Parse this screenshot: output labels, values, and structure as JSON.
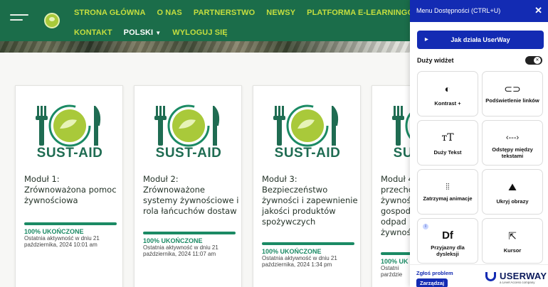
{
  "header": {
    "nav_row1": [
      "STRONA GŁÓWNA",
      "O NAS",
      "PARTNERSTWO",
      "NEWSY",
      "PLATFORMA E-LEARNINGOWA"
    ],
    "nav_row2": [
      "KONTAKT",
      "WYLOGUJ SIĘ"
    ],
    "language": "POLSKI",
    "colors": {
      "bar": "#1b6d4a",
      "link": "#c5de3f"
    }
  },
  "brand_text": "SUST-AID",
  "cards": [
    {
      "title": "Moduł 1:\nZrównoważona pomoc żywnościowa",
      "status": "100% UKOŃCZONE",
      "activity": "Ostatnia aktywność w dniu 21 października, 2024 10:01 am"
    },
    {
      "title": "Moduł 2:\nZrównoważone systemy żywnościowe i rola łańcuchów dostaw",
      "status": "100% UKOŃCZONE",
      "activity": "Ostatnia aktywność w dniu 21 października, 2024 11:07 am"
    },
    {
      "title": "Moduł 3:\nBezpieczeństwo żywności i zapewnienie jakości produktów spożywczych",
      "status": "100% UKOŃCZONE",
      "activity": "Ostatnia aktywność w dniu 21 października, 2024 1:34 pm"
    },
    {
      "title": "Moduł 4\nprzechc\nżywnośc\ngospod\nodpad\nżywnośc",
      "status": "100% UK",
      "activity": "Ostatni\nparździe"
    }
  ],
  "accessibility": {
    "title": "Menu Dostępności (CTRL+U)",
    "how_button": "Jak działa UserWay",
    "big_widget": "Duży widżet",
    "tiles": [
      {
        "label": "Kontrast +",
        "icon": "contrast-icon"
      },
      {
        "label": "Podświetlenie linków",
        "icon": "link-icon"
      },
      {
        "label": "Duży Tekst",
        "icon": "text-size-icon"
      },
      {
        "label": "Odstępy między tekstami",
        "icon": "text-spacing-icon"
      },
      {
        "label": "Zatrzymaj animacje",
        "icon": "pause-icon"
      },
      {
        "label": "Ukryj obrazy",
        "icon": "hide-image-icon"
      },
      {
        "label": "Przyjazny dla dysleksji",
        "icon": "dyslexia-icon"
      },
      {
        "label": "Kursor",
        "icon": "cursor-icon"
      }
    ],
    "report": "Zgłoś problem",
    "manage": "Zarządzaj",
    "brand": "USERWAY",
    "brand_sub": "a Level Access company",
    "accent": "#132bb3"
  }
}
